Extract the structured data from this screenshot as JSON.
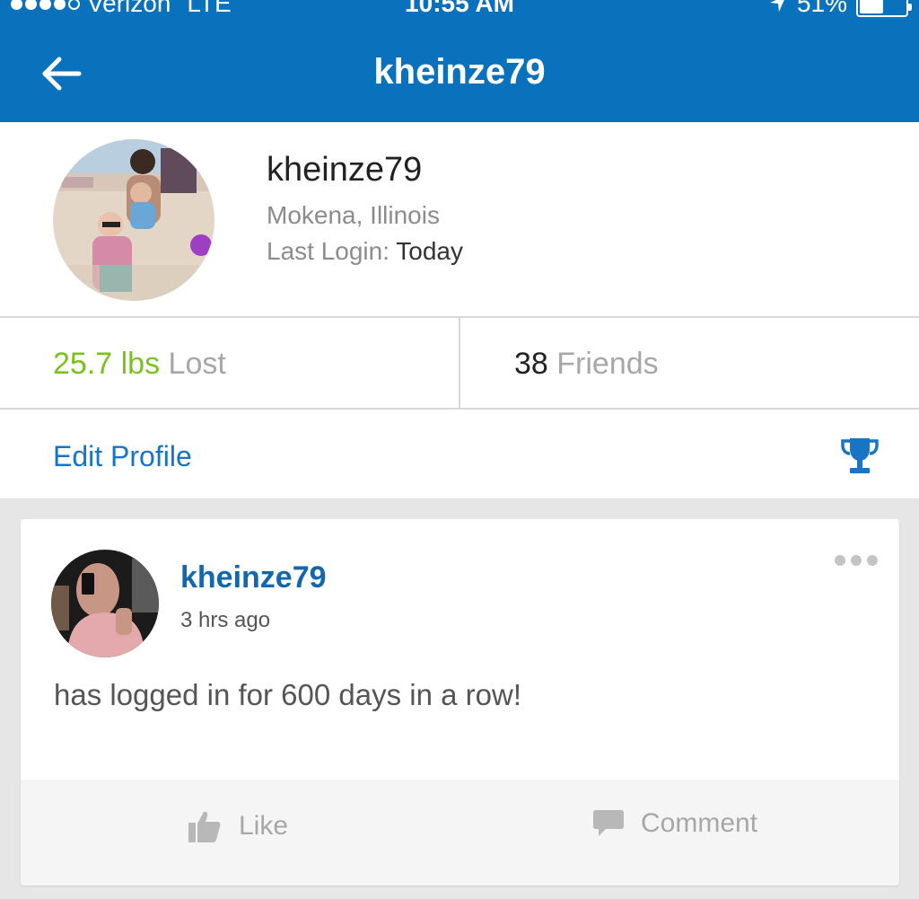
{
  "status_bar": {
    "carrier": "Verizon",
    "network": "LTE",
    "time": "10:55 AM",
    "battery": "51%",
    "battery_level": 0.51
  },
  "header": {
    "title": "kheinze79",
    "back_icon": "arrow-left-icon"
  },
  "profile": {
    "username": "kheinze79",
    "location": "Mokena, Illinois",
    "last_login_label": "Last Login:",
    "last_login_value": "Today"
  },
  "stats": {
    "weight_value": "25.7 lbs",
    "weight_label": "Lost",
    "friends_value": "38",
    "friends_label": "Friends"
  },
  "actions_row": {
    "edit_profile": "Edit Profile",
    "trophy_icon": "trophy-icon"
  },
  "feed": {
    "post": {
      "username": "kheinze79",
      "time": "3 hrs ago",
      "text": "has logged in for 600 days in a row!",
      "like_label": "Like",
      "comment_label": "Comment"
    }
  },
  "colors": {
    "brand_blue": "#0a71bd",
    "link_blue": "#1775c4",
    "weight_green": "#7ac121",
    "muted_gray": "#a7a7a7"
  }
}
